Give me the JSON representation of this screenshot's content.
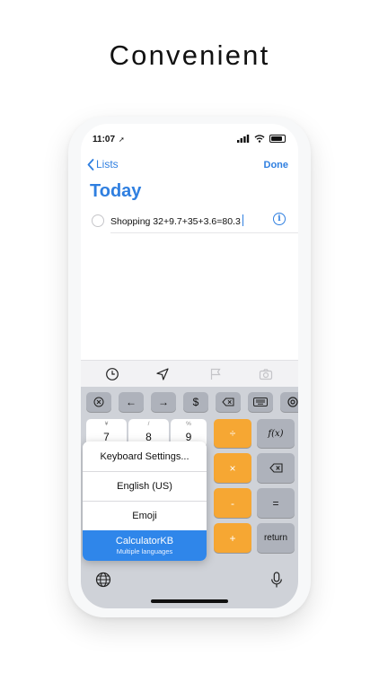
{
  "headline": "Convenient",
  "status": {
    "time": "11:07",
    "location_arrow": "➚"
  },
  "nav": {
    "back_label": "Lists",
    "done_label": "Done"
  },
  "list": {
    "title": "Today",
    "item_text": "Shopping 32+9.7+35+3.6=80.3",
    "info_glyph": "i"
  },
  "keyboard": {
    "function_row": [
      {
        "name": "clear-key",
        "label": "✕"
      },
      {
        "name": "left-arrow-key",
        "label": "←"
      },
      {
        "name": "right-arrow-key",
        "label": "→"
      },
      {
        "name": "currency-key",
        "label": "$"
      },
      {
        "name": "delete-left-key",
        "label": "⌫"
      },
      {
        "name": "keyboard-key",
        "label": "⌨"
      },
      {
        "name": "settings-key",
        "label": "⚙"
      }
    ],
    "number_keys": [
      {
        "main": "7",
        "sub": "¥"
      },
      {
        "main": "8",
        "sub": "/"
      },
      {
        "main": "9",
        "sub": "%"
      }
    ],
    "operators": [
      "÷",
      "×",
      "-",
      "+"
    ],
    "right_keys": [
      "f(x)",
      "⌫",
      "=",
      "return"
    ],
    "menu": {
      "items": [
        "Keyboard Settings...",
        "English (US)",
        "Emoji"
      ],
      "selected": "CalculatorKB",
      "selected_sub": "Multiple languages"
    }
  },
  "colors": {
    "accent": "#2f7fe0",
    "operator": "#f6a733",
    "selected": "#2f86ea"
  }
}
